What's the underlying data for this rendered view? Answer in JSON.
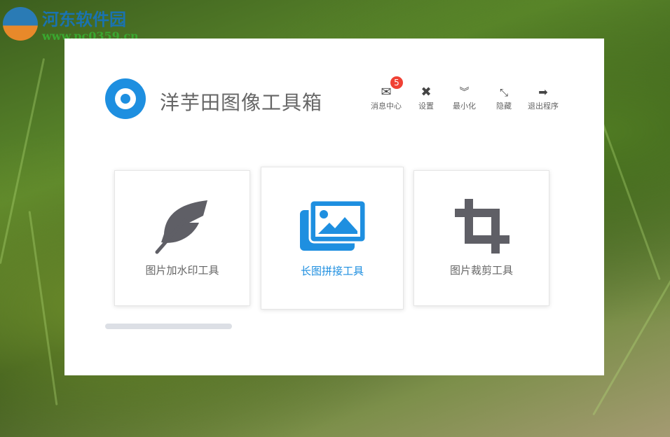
{
  "watermark": {
    "name": "河东软件园",
    "url": "www.pc0359.cn"
  },
  "app": {
    "title": "洋芋田图像工具箱"
  },
  "toolbar": [
    {
      "label": "消息中心",
      "icon": "envelope-icon",
      "badge": "5"
    },
    {
      "label": "设置",
      "icon": "tools-icon"
    },
    {
      "label": "最小化",
      "icon": "double-chevron-down-icon"
    },
    {
      "label": "隐藏",
      "icon": "compress-icon"
    },
    {
      "label": "退出程序",
      "icon": "sign-out-icon"
    }
  ],
  "cards": [
    {
      "label": "图片加水印工具",
      "icon": "feather-icon"
    },
    {
      "label": "长图拼接工具",
      "icon": "images-icon",
      "active": true
    },
    {
      "label": "图片裁剪工具",
      "icon": "crop-icon"
    }
  ],
  "colors": {
    "accent": "#1e8fe0",
    "badge": "#f04134",
    "icon": "#5f5f66"
  }
}
